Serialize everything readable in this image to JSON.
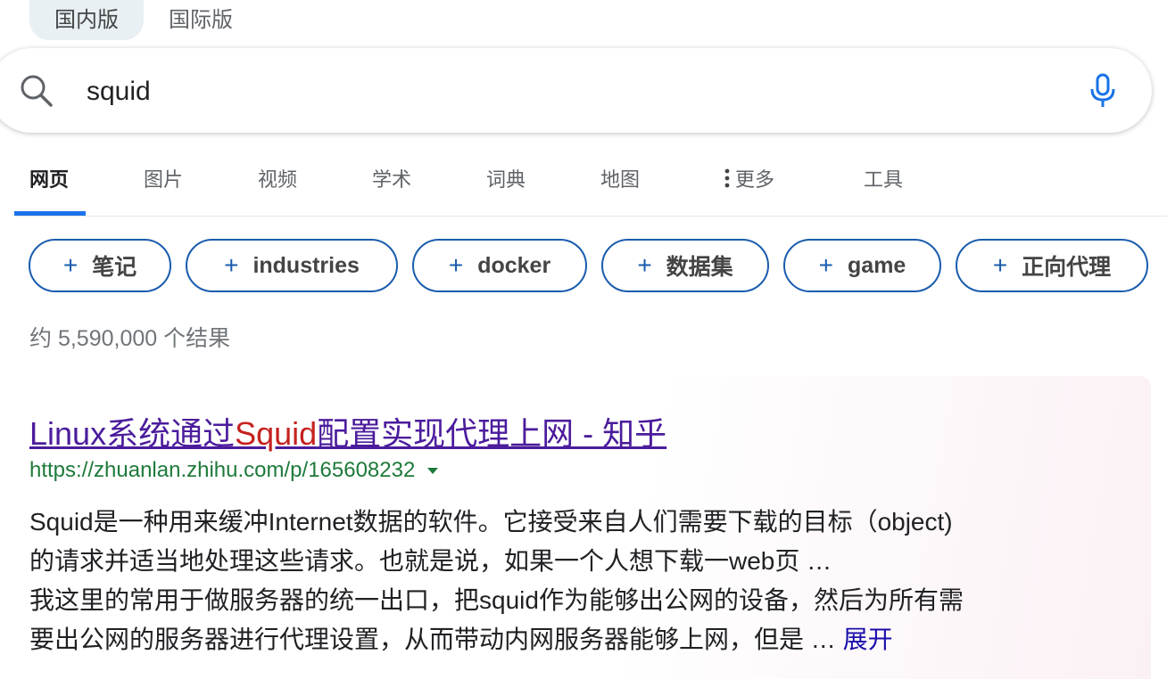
{
  "region": {
    "domestic": "国内版",
    "international": "国际版"
  },
  "search": {
    "query": "squid"
  },
  "tabs": [
    {
      "label": "网页"
    },
    {
      "label": "图片"
    },
    {
      "label": "视频"
    },
    {
      "label": "学术"
    },
    {
      "label": "词典"
    },
    {
      "label": "地图"
    },
    {
      "label": "更多"
    },
    {
      "label": "工具"
    }
  ],
  "chips": [
    {
      "label": "笔记"
    },
    {
      "label": "industries"
    },
    {
      "label": "docker"
    },
    {
      "label": "数据集"
    },
    {
      "label": "game"
    },
    {
      "label": "正向代理"
    }
  ],
  "result_count": "约 5,590,000 个结果",
  "result": {
    "title_before": "Linux系统通过",
    "title_highlight": "Squid",
    "title_after": "配置实现代理上网 - 知乎",
    "url": "https://zhuanlan.zhihu.com/p/165608232",
    "lines": [
      "Squid是一种用来缓冲Internet数据的软件。它接受来自人们需要下载的目标（object)",
      "的请求并适当地处理这些请求。也就是说，如果一个人想下载一web页 …",
      "我这里的常用于做服务器的统一出口，把squid作为能够出公网的设备，然后为所有需",
      "要出公网的服务器进行代理设置，从而带动内网服务器能够上网，但是 … "
    ],
    "expand_label": "展开"
  },
  "colors": {
    "accent_blue": "#1a73e8",
    "chip_border": "#1a5cad",
    "link_title": "#4b1c9c",
    "keyword_highlight": "#c5221f",
    "url_green": "#1e7a3a",
    "expand_link": "#1a0dab"
  },
  "icons": {
    "search": "magnifier-icon",
    "mic": "microphone-icon",
    "more": "vertical-dots-icon",
    "chip_add": "plus-icon",
    "url_menu": "caret-down-icon"
  }
}
